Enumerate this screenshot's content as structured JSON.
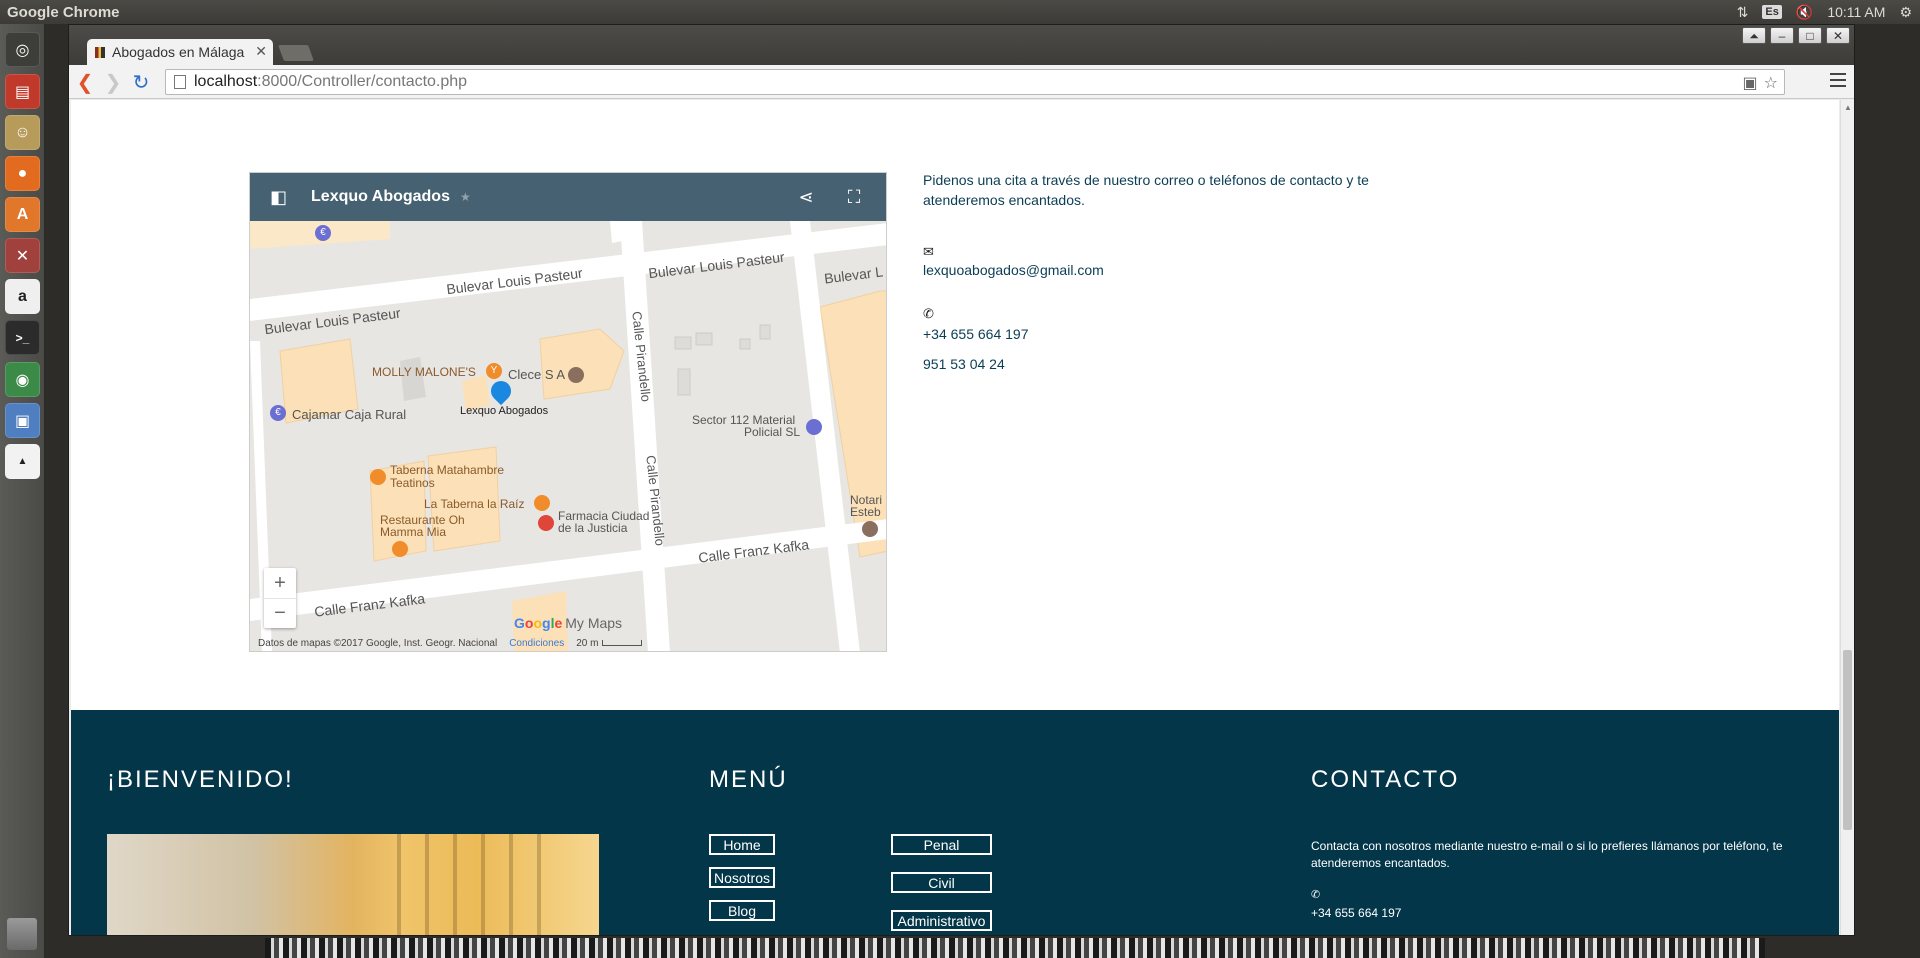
{
  "os": {
    "app_name": "Google Chrome",
    "keyboard_layout": "Es",
    "clock": "10:11 AM"
  },
  "launcher": {
    "items": [
      "dash-home",
      "files",
      "gimp",
      "firefox",
      "software-center",
      "settings",
      "amazon",
      "terminal",
      "chrome",
      "virtualbox",
      "pixel-app"
    ]
  },
  "browser": {
    "tab_title": "Abogados en Málaga",
    "url_host": "localhost",
    "url_path": ":8000/Controller/contacto.php"
  },
  "map": {
    "title": "Lexquo Abogados",
    "streets": [
      "Bulevar Louis Pasteur",
      "Bulevar Louis Pasteur",
      "Bulevar L",
      "Calle Pirandello",
      "Calle Pirandello",
      "Calle Franz Kafka",
      "Calle Franz Kafka"
    ],
    "places": {
      "molly": "MOLLY MALONE'S",
      "clece": "Clece S A",
      "lexquo": "Lexquo Abogados",
      "cajamar": "Cajamar Caja Rural",
      "sector1": "Sector 112 Material",
      "sector2": "Policial SL",
      "taberna1": "Taberna Matahambre",
      "taberna2": "Teatinos",
      "raiz": "La Taberna la Raíz",
      "farmacia1": "Farmacia Ciudad",
      "farmacia2": "de la Justicia",
      "restaurante1": "Restaurante Oh",
      "restaurante2": "Mamma Mia",
      "notaria1": "Notari",
      "notaria2": "Esteb"
    },
    "attribution": "Datos de mapas ©2017 Google, Inst. Geogr. Nacional",
    "terms": "Condiciones",
    "scale": "20 m",
    "logo_suffix": "My Maps"
  },
  "contact": {
    "intro": "Pidenos una cita a través de nuestro correo o teléfonos de contacto y te atenderemos encantados.",
    "email": "lexquoabogados@gmail.com",
    "phone1": "+34 655 664 197",
    "phone2": "951 53 04 24"
  },
  "footer": {
    "welcome_heading": "¡BIENVENIDO!",
    "menu_heading": "MENÚ",
    "contact_heading": "CONTACTO",
    "menu_left": [
      "Home",
      "Nosotros",
      "Blog"
    ],
    "menu_right": [
      "Penal",
      "Civil",
      "Administrativo"
    ],
    "contact_text": "Contacta con nosotros mediante nuestro e-mail o si lo prefieres llámanos por teléfono, te atenderemos encantados.",
    "contact_phone": "+34 655 664 197"
  }
}
